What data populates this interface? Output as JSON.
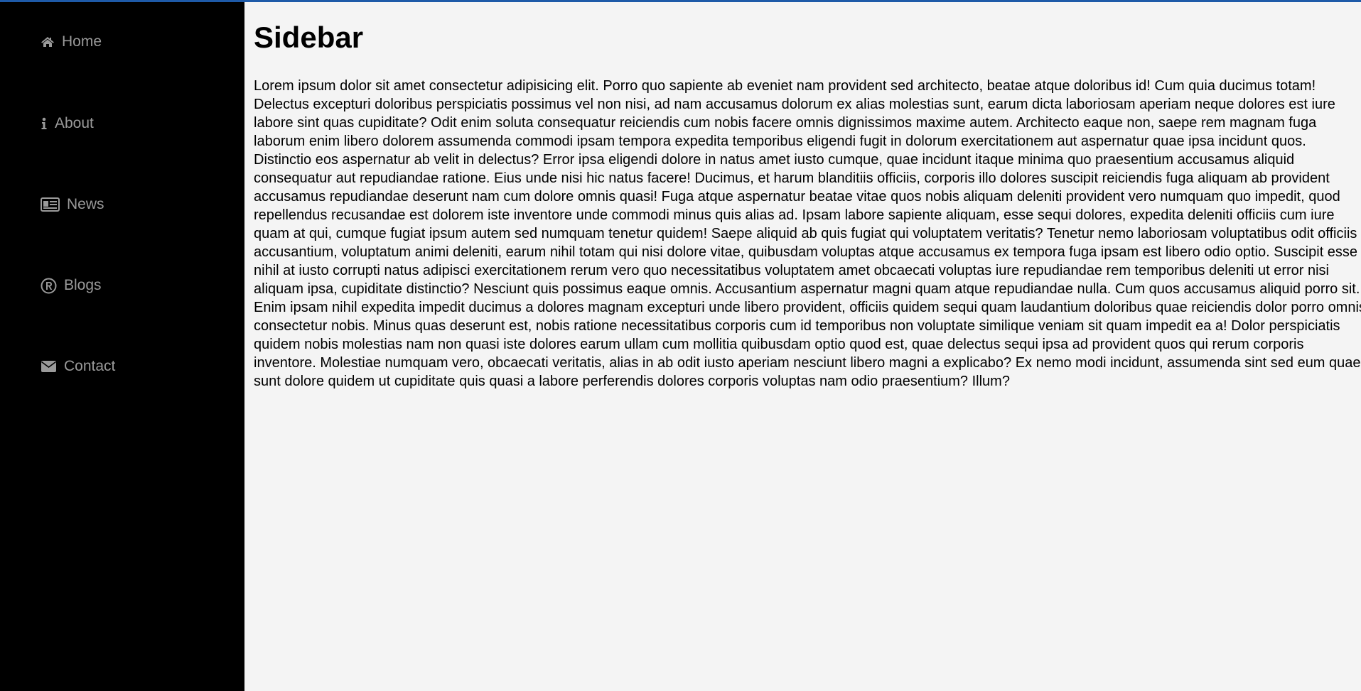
{
  "sidebar": {
    "items": [
      {
        "label": "Home",
        "icon": "home-icon"
      },
      {
        "label": "About",
        "icon": "info-icon"
      },
      {
        "label": "News",
        "icon": "newspaper-icon"
      },
      {
        "label": "Blogs",
        "icon": "registered-icon"
      },
      {
        "label": "Contact",
        "icon": "envelope-icon"
      }
    ]
  },
  "main": {
    "title": "Sidebar",
    "body": "Lorem ipsum dolor sit amet consectetur adipisicing elit. Porro quo sapiente ab eveniet nam provident sed architecto, beatae atque doloribus id! Cum quia ducimus totam! Delectus excepturi doloribus perspiciatis possimus vel non nisi, ad nam accusamus dolorum ex alias molestias sunt, earum dicta laboriosam aperiam neque dolores est iure labore sint quas cupiditate? Odit enim soluta consequatur reiciendis cum nobis facere omnis dignissimos maxime autem. Architecto eaque non, saepe rem magnam fuga laborum enim libero dolorem assumenda commodi ipsam tempora expedita temporibus eligendi fugit in dolorum exercitationem aut aspernatur quae ipsa incidunt quos. Distinctio eos aspernatur ab velit in delectus? Error ipsa eligendi dolore in natus amet iusto cumque, quae incidunt itaque minima quo praesentium accusamus aliquid consequatur aut repudiandae ratione. Eius unde nisi hic natus facere! Ducimus, et harum blanditiis officiis, corporis illo dolores suscipit reiciendis fuga aliquam ab provident accusamus repudiandae deserunt nam cum dolore omnis quasi! Fuga atque aspernatur beatae vitae quos nobis aliquam deleniti provident vero numquam quo impedit, quod repellendus recusandae est dolorem iste inventore unde commodi minus quis alias ad. Ipsam labore sapiente aliquam, esse sequi dolores, expedita deleniti officiis cum iure quam at qui, cumque fugiat ipsum autem sed numquam tenetur quidem! Saepe aliquid ab quis fugiat qui voluptatem veritatis? Tenetur nemo laboriosam voluptatibus odit officiis accusantium, voluptatum animi deleniti, earum nihil totam qui nisi dolore vitae, quibusdam voluptas atque accusamus ex tempora fuga ipsam est libero odio optio. Suscipit esse nihil at iusto corrupti natus adipisci exercitationem rerum vero quo necessitatibus voluptatem amet obcaecati voluptas iure repudiandae rem temporibus deleniti ut error nisi aliquam ipsa, cupiditate distinctio? Nesciunt quis possimus eaque omnis. Accusantium aspernatur magni quam atque repudiandae nulla. Cum quos accusamus aliquid porro sit. Enim ipsam nihil expedita impedit ducimus a dolores magnam excepturi unde libero provident, officiis quidem sequi quam laudantium doloribus quae reiciendis dolor porro omnis consectetur nobis. Minus quas deserunt est, nobis ratione necessitatibus corporis cum id temporibus non voluptate similique veniam sit quam impedit ea a! Dolor perspiciatis quidem nobis molestias nam non quasi iste dolores earum ullam cum mollitia quibusdam optio quod est, quae delectus sequi ipsa ad provident quos qui rerum corporis inventore. Molestiae numquam vero, obcaecati veritatis, alias in ab odit iusto aperiam nesciunt libero magni a explicabo? Ex nemo modi incidunt, assumenda sint sed eum quae, sunt dolore quidem ut cupiditate quis quasi a labore perferendis dolores corporis voluptas nam odio praesentium? Illum?"
  },
  "colors": {
    "sidebar_bg": "#000000",
    "nav_text": "#9a9a9a",
    "page_bg": "#f4f4f4",
    "top_accent": "#1e5aa8"
  }
}
